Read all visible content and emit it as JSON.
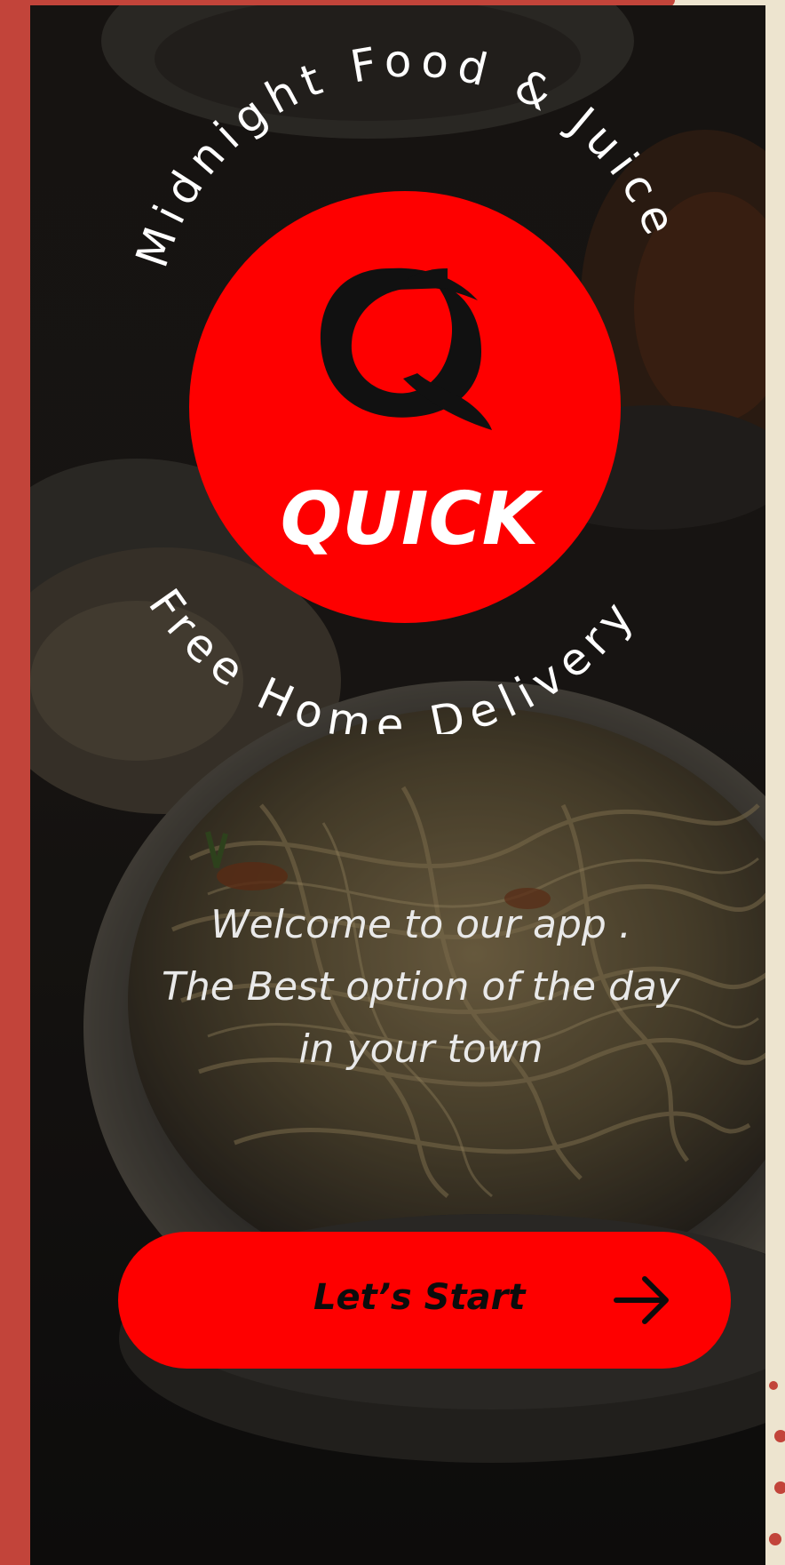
{
  "app": {
    "brand_name": "QUICK",
    "tagline_top": "Midnight Food & Juice",
    "tagline_bottom": "Free Home Delivery"
  },
  "welcome": {
    "line1": "Welcome to our app .",
    "line2": "The Best option of the day",
    "line3": "in your town"
  },
  "cta": {
    "label": "Let’s Start",
    "icon": "arrow-right-icon"
  },
  "colors": {
    "accent": "#fe0000",
    "frame": "#c2443a",
    "backdrop": "#ede4cf"
  },
  "icons": {
    "logo": "q-logo-icon",
    "background": "noodle-bowl-photo"
  }
}
